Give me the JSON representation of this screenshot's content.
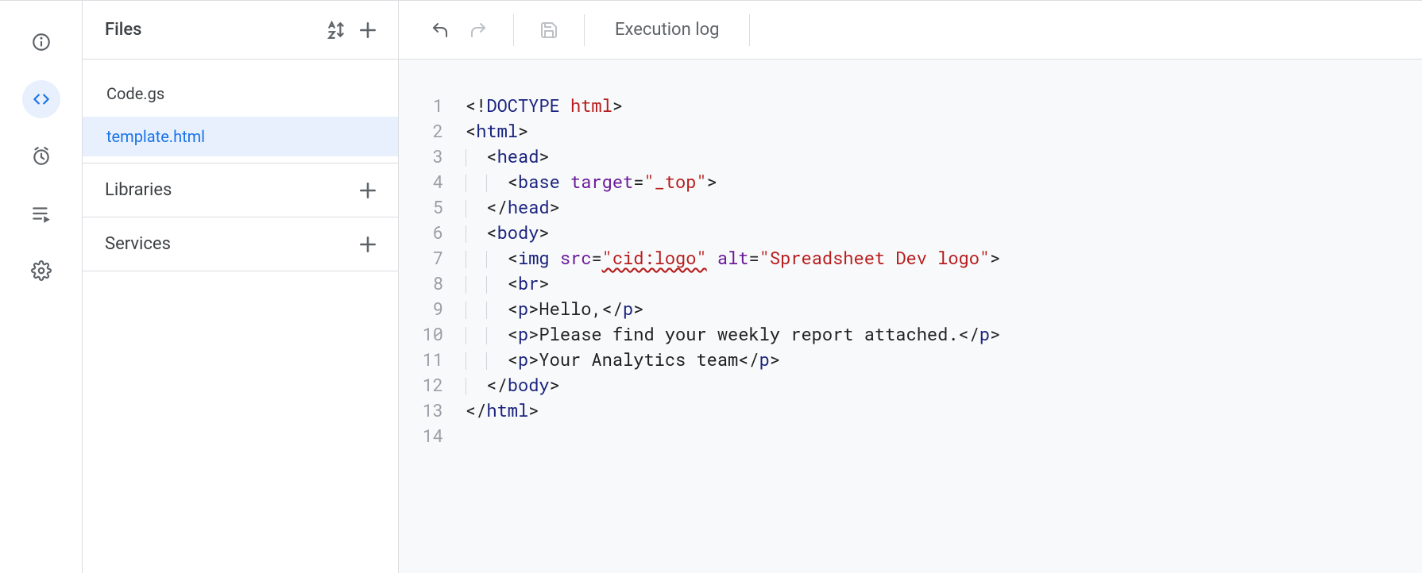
{
  "rail": {
    "items": [
      {
        "name": "info-icon"
      },
      {
        "name": "editor-icon",
        "active": true
      },
      {
        "name": "triggers-icon"
      },
      {
        "name": "executions-icon"
      },
      {
        "name": "settings-icon"
      }
    ]
  },
  "sidebar": {
    "title": "Files",
    "files": [
      {
        "label": "Code.gs",
        "selected": false
      },
      {
        "label": "template.html",
        "selected": true
      }
    ],
    "sections": [
      {
        "label": "Libraries"
      },
      {
        "label": "Services"
      }
    ]
  },
  "toolbar": {
    "exec_log_label": "Execution log"
  },
  "editor": {
    "line_count": 14,
    "cursor_line": 14,
    "lines": [
      {
        "n": 1,
        "indent": 0,
        "tokens": [
          [
            "punct",
            "<!"
          ],
          [
            "tag",
            "DOCTYPE"
          ],
          [
            "punct",
            " "
          ],
          [
            "str",
            "html"
          ],
          [
            "punct",
            ">"
          ]
        ]
      },
      {
        "n": 2,
        "indent": 0,
        "tokens": [
          [
            "punct",
            "<"
          ],
          [
            "tag",
            "html"
          ],
          [
            "punct",
            ">"
          ]
        ]
      },
      {
        "n": 3,
        "indent": 1,
        "tokens": [
          [
            "punct",
            "<"
          ],
          [
            "tag",
            "head"
          ],
          [
            "punct",
            ">"
          ]
        ]
      },
      {
        "n": 4,
        "indent": 2,
        "tokens": [
          [
            "punct",
            "<"
          ],
          [
            "tag",
            "base"
          ],
          [
            "punct",
            " "
          ],
          [
            "attr",
            "target"
          ],
          [
            "punct",
            "="
          ],
          [
            "str",
            "\"_top\""
          ],
          [
            "punct",
            ">"
          ]
        ]
      },
      {
        "n": 5,
        "indent": 1,
        "tokens": [
          [
            "punct",
            "</"
          ],
          [
            "tag",
            "head"
          ],
          [
            "punct",
            ">"
          ]
        ]
      },
      {
        "n": 6,
        "indent": 1,
        "tokens": [
          [
            "punct",
            "<"
          ],
          [
            "tag",
            "body"
          ],
          [
            "punct",
            ">"
          ]
        ]
      },
      {
        "n": 7,
        "indent": 2,
        "tokens": [
          [
            "punct",
            "<"
          ],
          [
            "tag",
            "img"
          ],
          [
            "punct",
            " "
          ],
          [
            "attr",
            "src"
          ],
          [
            "punct",
            "="
          ],
          [
            "str-wavy",
            "\"cid:logo\""
          ],
          [
            "punct",
            " "
          ],
          [
            "attr",
            "alt"
          ],
          [
            "punct",
            "="
          ],
          [
            "str",
            "\"Spreadsheet Dev logo\""
          ],
          [
            "punct",
            ">"
          ]
        ]
      },
      {
        "n": 8,
        "indent": 2,
        "tokens": [
          [
            "punct",
            "<"
          ],
          [
            "tag",
            "br"
          ],
          [
            "punct",
            ">"
          ]
        ]
      },
      {
        "n": 9,
        "indent": 2,
        "tokens": [
          [
            "punct",
            "<"
          ],
          [
            "tag",
            "p"
          ],
          [
            "punct",
            ">"
          ],
          [
            "text",
            "Hello,"
          ],
          [
            "punct",
            "</"
          ],
          [
            "tag",
            "p"
          ],
          [
            "punct",
            ">"
          ]
        ]
      },
      {
        "n": 10,
        "indent": 2,
        "tokens": [
          [
            "punct",
            "<"
          ],
          [
            "tag",
            "p"
          ],
          [
            "punct",
            ">"
          ],
          [
            "text",
            "Please find your weekly report attached."
          ],
          [
            "punct",
            "</"
          ],
          [
            "tag",
            "p"
          ],
          [
            "punct",
            ">"
          ]
        ]
      },
      {
        "n": 11,
        "indent": 2,
        "tokens": [
          [
            "punct",
            "<"
          ],
          [
            "tag",
            "p"
          ],
          [
            "punct",
            ">"
          ],
          [
            "text",
            "Your Analytics team"
          ],
          [
            "punct",
            "</"
          ],
          [
            "tag",
            "p"
          ],
          [
            "punct",
            ">"
          ]
        ]
      },
      {
        "n": 12,
        "indent": 1,
        "tokens": [
          [
            "punct",
            "</"
          ],
          [
            "tag",
            "body"
          ],
          [
            "punct",
            ">"
          ]
        ]
      },
      {
        "n": 13,
        "indent": 0,
        "tokens": [
          [
            "punct",
            "</"
          ],
          [
            "tag",
            "html"
          ],
          [
            "punct",
            ">"
          ]
        ]
      },
      {
        "n": 14,
        "indent": 0,
        "tokens": []
      }
    ]
  }
}
